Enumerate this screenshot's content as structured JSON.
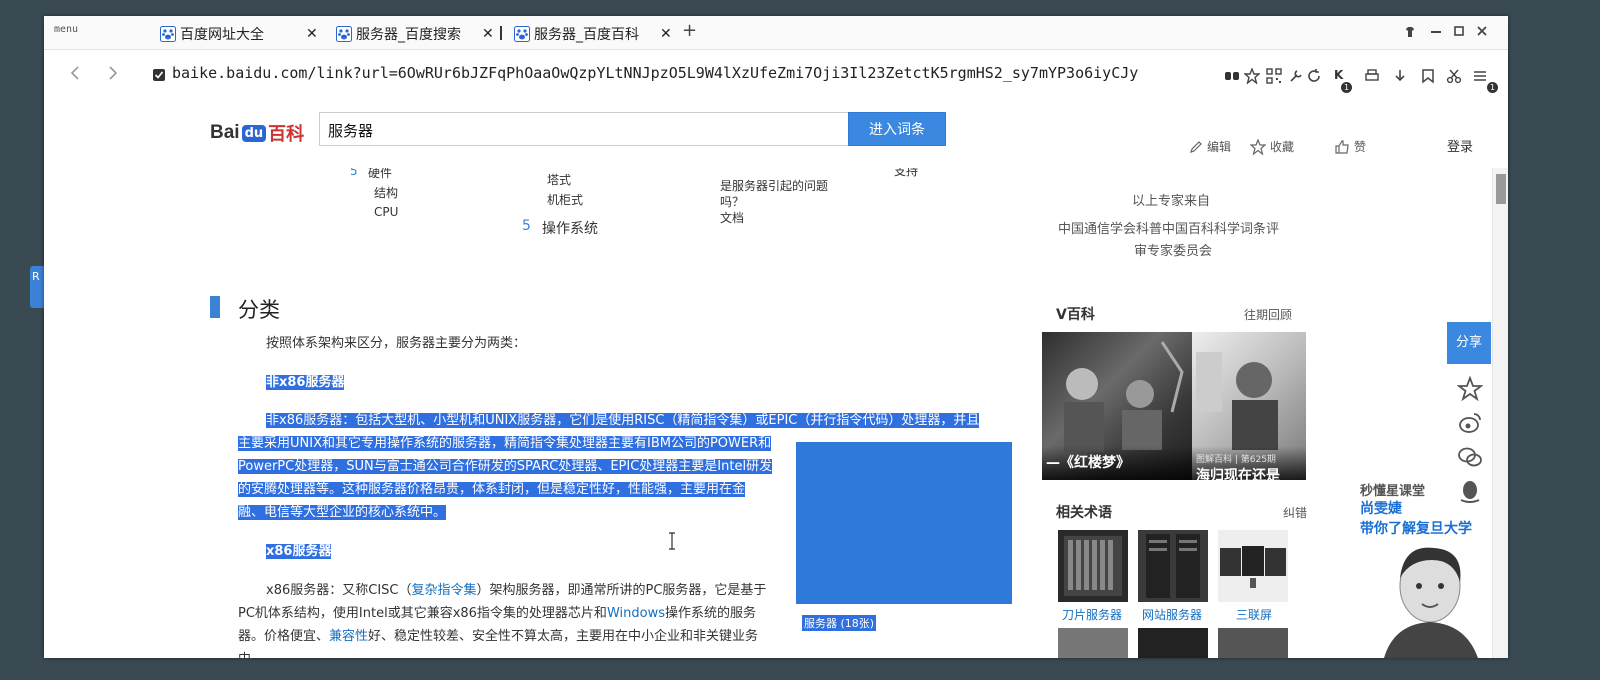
{
  "desktop": {
    "side_tab_label": "R"
  },
  "browser": {
    "menu_label": "menu",
    "tabs": [
      {
        "label": "百度网址大全",
        "close": "✕"
      },
      {
        "label": "服务器_百度搜索",
        "close": "✕"
      },
      {
        "label": "服务器_百度百科",
        "close": "✕"
      }
    ],
    "new_tab": "+",
    "url": "baike.baidu.com/link?url=6OwRUr6bJZFqPhOaaOwQzpYLtNNJpzO5L9W4lXzUfeZmi7Oji3Il23ZetctK5rgmHS2_sy7mYP3o6iyCJy",
    "badges": {
      "k_count": "1",
      "right_count": "1"
    }
  },
  "header": {
    "logo": {
      "bai": "Bai",
      "du": "du",
      "baike": "百科"
    },
    "search_value": "服务器",
    "search_button": "进入词条",
    "actions": {
      "edit": "编辑",
      "collect": "收藏",
      "like": "赞"
    },
    "login": "登录"
  },
  "toc": {
    "left_num": "5",
    "left_title": "硬件",
    "left_items": [
      "结构",
      "CPU"
    ],
    "mid_items": [
      "塔式",
      "机柜式"
    ],
    "mid_num": "5",
    "mid_title": "操作系统",
    "right_items": [
      "是服务器引起的问题",
      "吗？",
      "文档"
    ],
    "far_item": "支持"
  },
  "experts": {
    "title": "以上专家来自",
    "line1": "中国通信学会科普中国百科科学词条评",
    "line2": "审专家委员会"
  },
  "article": {
    "section_title": "分类",
    "intro": "按照体系架构来区分，服务器主要分为两类：",
    "h1": "非x86服务器",
    "p1": [
      "非x86服务器：包括大型机、小型机和UNIX服务器，它们是使用RISC（精简指令集）或EPIC（并行指令代码）处理器，并且",
      "主要采用UNIX和其它专用操作系统的服务器，精简指令集处理器主要有IBM公司的POWER和",
      "PowerPC处理器，SUN与富士通公司合作研发的SPARC处理器、EPIC处理器主要是Intel研发",
      "的安腾处理器等。这种服务器价格昂贵，体系封闭，但是稳定性好，性能强，主要用在金",
      "融、电信等大型企业的核心系统中。"
    ],
    "h2": "x86服务器",
    "p2": {
      "a": "x86服务器：又称CISC（",
      "link1": "复杂指令集",
      "b": "）架构服务器，即通常所讲的PC服务器，它是基于",
      "line2a": "PC机体系结构，使用Intel或其它兼容x86指令集的处理器芯片和",
      "link2": "Windows",
      "line2b": "操作系统的服务",
      "line3a": "器。价格便宜、",
      "link3": "兼容性",
      "line3b": "好、稳定性较差、安全性不算太高，主要用在中小企业和非关键业务",
      "line4": "中。"
    },
    "image_caption": "服务器 (18张)"
  },
  "vbaike": {
    "title": "V百科",
    "history": "往期回顾",
    "videos": [
      {
        "small": "",
        "big": "—《红楼梦》"
      },
      {
        "small": "图解百科 | 第625期",
        "big": "海归现在还是"
      }
    ]
  },
  "related": {
    "title": "相关术语",
    "fix": "纠错",
    "items": [
      "刀片服务器",
      "网站服务器",
      "三联屏"
    ]
  },
  "share": {
    "label": "分享"
  },
  "ad": {
    "line1": "秒懂星课堂",
    "line2": "尚雯婕",
    "line3": "带你了解复旦大学"
  }
}
